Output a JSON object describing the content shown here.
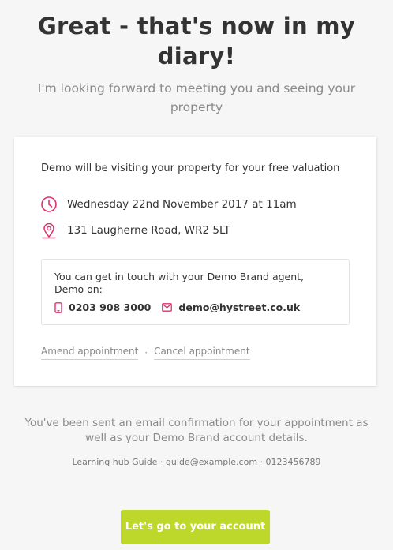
{
  "header": {
    "title": "Great - that's now in my diary!",
    "subtitle": "I'm looking forward to meeting you and seeing your property"
  },
  "card": {
    "visit_text": "Demo will be visiting your property for your free valuation",
    "date": "Wednesday 22nd November 2017 at 11am",
    "address": "131 Laugherne Road, WR2 5LT",
    "contact": {
      "text": "You can get in touch with your Demo Brand agent, Demo on:",
      "phone": "0203 908 3000",
      "email": "demo@hystreet.co.uk"
    },
    "links": {
      "amend": "Amend appointment",
      "separator": "·",
      "cancel": "Cancel appointment"
    }
  },
  "footer": {
    "confirmation": "You've been sent an email confirmation for your appointment as well as your Demo Brand account details.",
    "guide": "Learning hub Guide · guide@example.com · 0123456789",
    "cta_label": "Let's go to your account"
  },
  "colors": {
    "accent_icon": "#e0316b",
    "cta_background": "#bdd72b"
  },
  "icons": [
    "clock-icon",
    "map-pin-icon",
    "phone-icon",
    "mail-icon"
  ]
}
